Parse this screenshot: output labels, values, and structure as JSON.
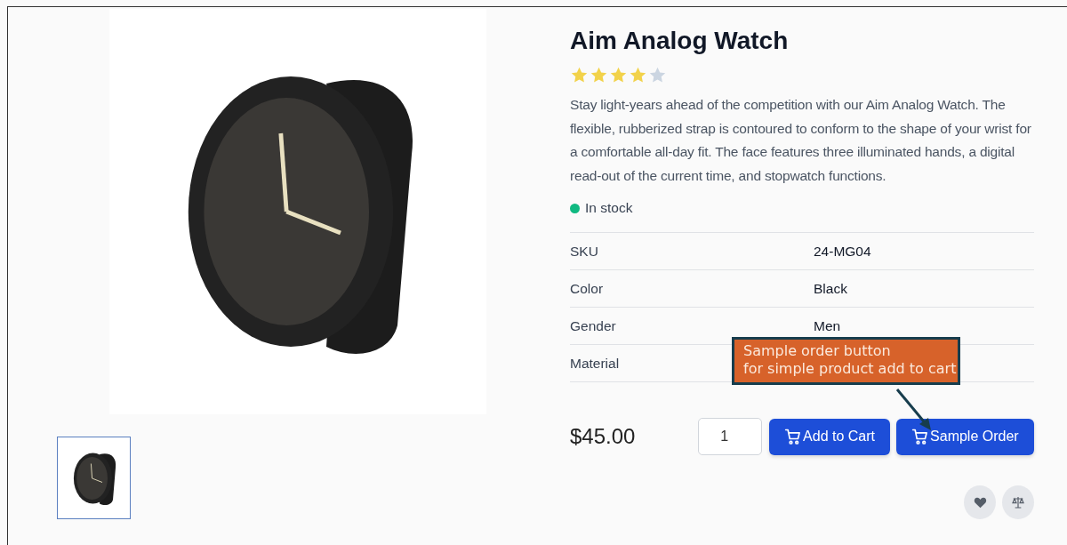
{
  "gallery": {
    "thumbnails": [
      {
        "selected": true
      }
    ]
  },
  "product": {
    "title": "Aim Analog Watch",
    "stars": 4,
    "description": "Stay light-years ahead of the competition with our Aim Analog Watch. The flexible, rubberized strap is contoured to conform to the shape of your wrist for a comfortable all-day fit. The face features three illuminated hands, a digital read-out of the current time, and stopwatch functions.",
    "stock": {
      "in_stock": true,
      "label": "In stock"
    },
    "attributes": [
      {
        "label": "SKU",
        "value": "24-MG04"
      },
      {
        "label": "Color",
        "value": "Black"
      },
      {
        "label": "Gender",
        "value": "Men"
      },
      {
        "label": "Material"
      }
    ],
    "price": "$45.00",
    "quantity": "1",
    "buttons": [
      {
        "label": "Add to Cart"
      },
      {
        "label": "Sample Order"
      }
    ]
  },
  "callout": {
    "lines": [
      "Sample order button",
      "for simple product add to cart"
    ]
  }
}
